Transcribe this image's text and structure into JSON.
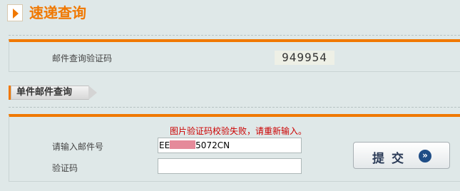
{
  "header": {
    "title": "速递查询",
    "icon": "orange-arrow-icon"
  },
  "mail_query": {
    "label": "邮件查询验证码",
    "captcha_text": "949954"
  },
  "tab": {
    "label": "单件邮件查询"
  },
  "form": {
    "error_message": "图片验证码校验失败，请重新输入。",
    "mail_number_label": "请输入邮件号",
    "mail_number_prefix": "EE",
    "mail_number_suffix": "5072CN",
    "captcha_label": "验证码",
    "captcha_value": "",
    "submit_label": "提交",
    "submit_icon": "double-chevron-right-icon"
  },
  "colors": {
    "accent": "#f07800",
    "error": "#cc0000",
    "button_icon": "#1f4d86"
  }
}
